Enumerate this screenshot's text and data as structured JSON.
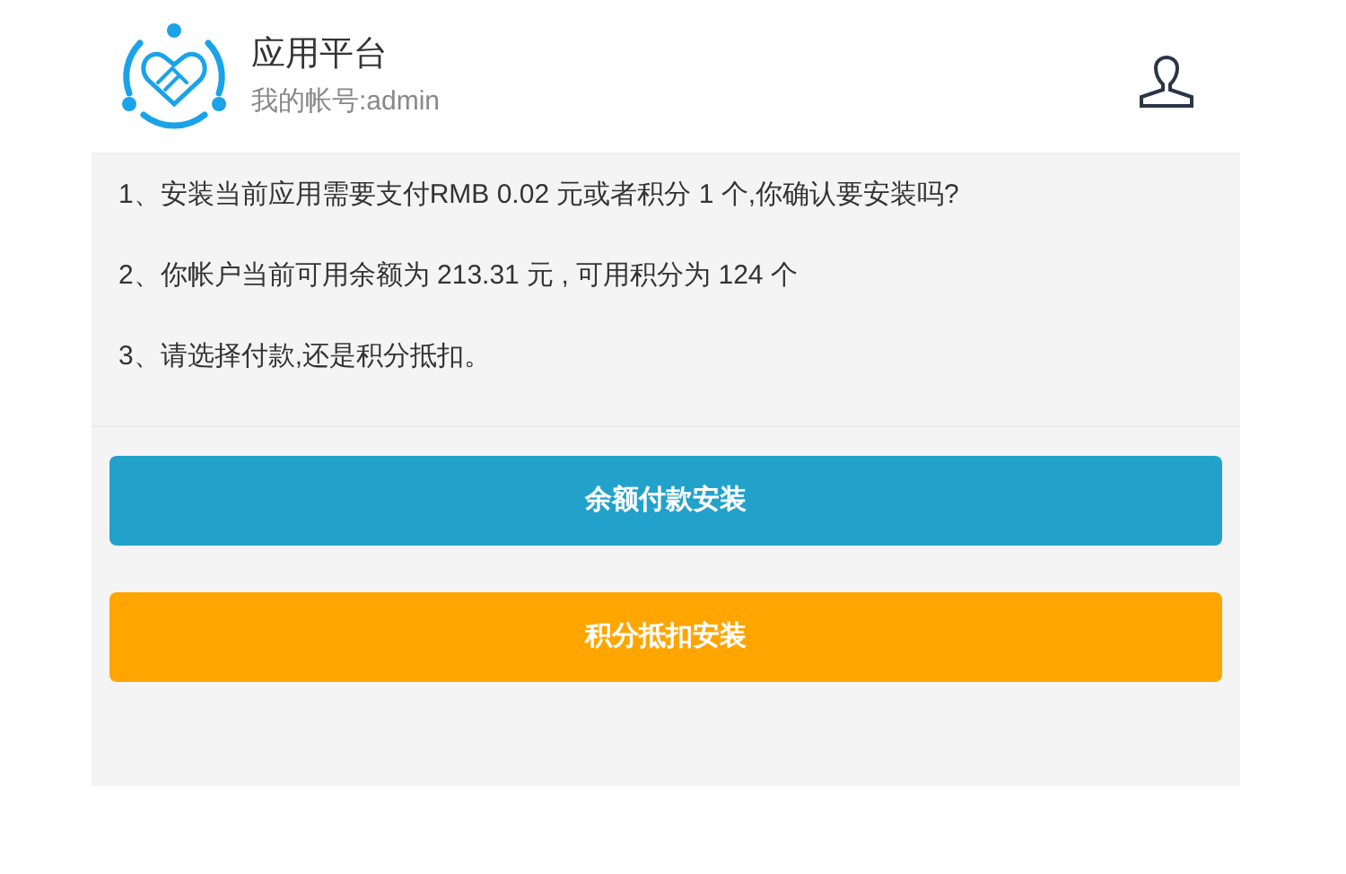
{
  "header": {
    "title": "应用平台",
    "account": "我的帐号:admin"
  },
  "notices": [
    "1、安装当前应用需要支付RMB 0.02 元或者积分 1 个,你确认要安装吗?",
    "2、你帐户当前可用余额为 213.31 元 , 可用积分为 124 个",
    "3、请选择付款,还是积分抵扣。"
  ],
  "buttons": [
    {
      "label": "余额付款安装",
      "kind": "primary"
    },
    {
      "label": "积分抵扣安装",
      "kind": "warning"
    }
  ]
}
